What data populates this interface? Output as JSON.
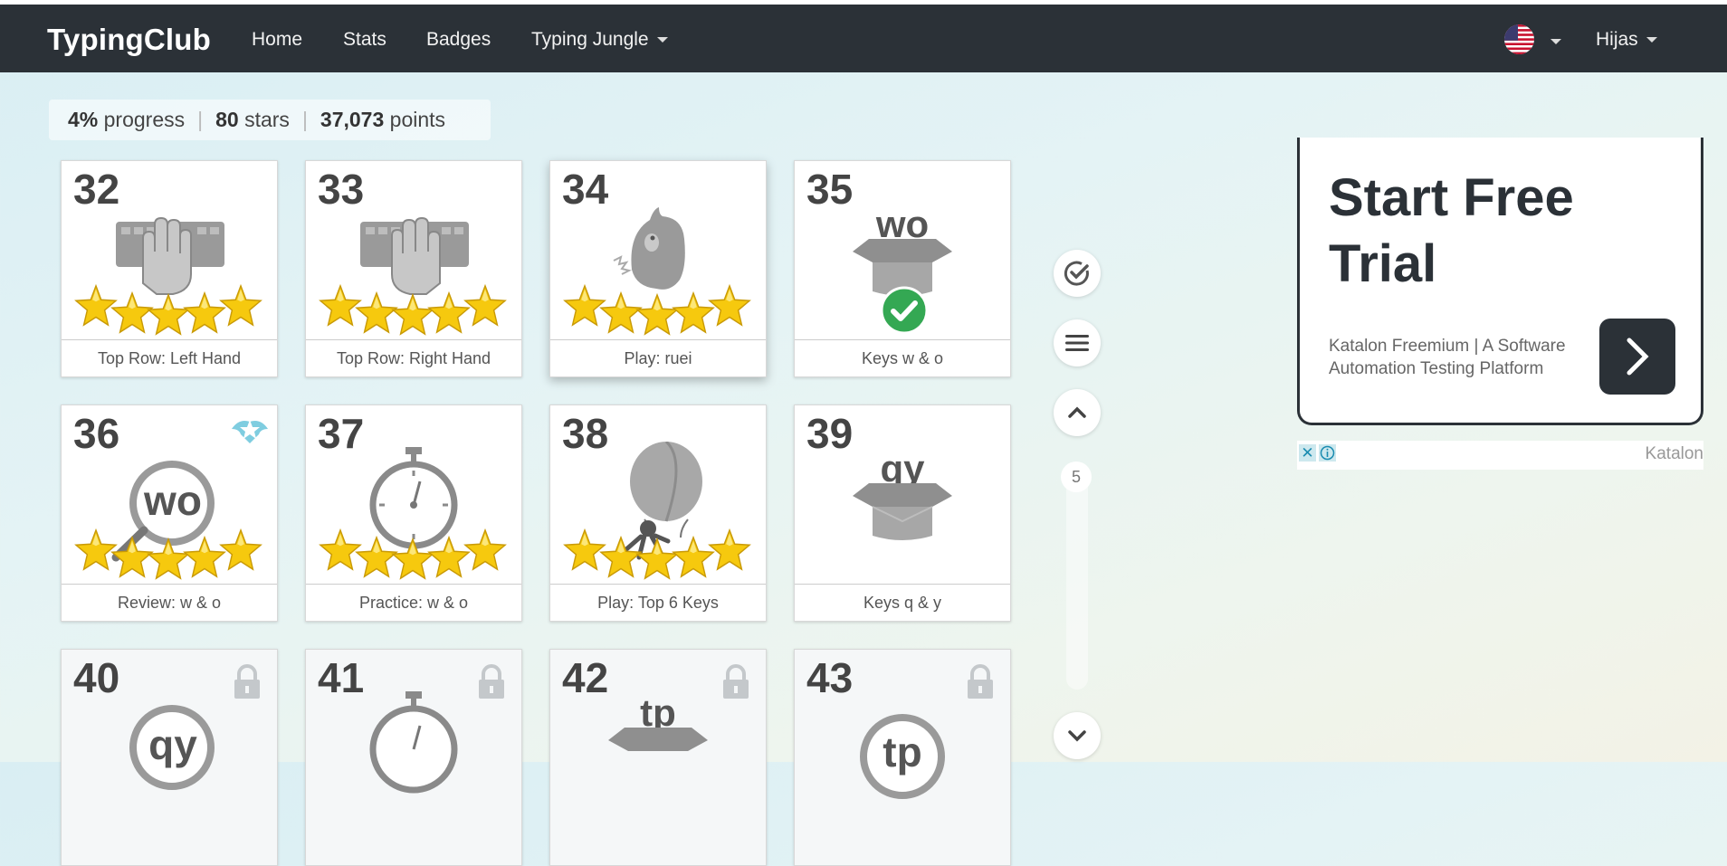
{
  "navbar": {
    "brand": "TypingClub",
    "links": [
      "Home",
      "Stats",
      "Badges",
      "Typing Jungle"
    ],
    "user": "Hijas",
    "language_icon": "us-flag-icon"
  },
  "progress": {
    "percent": "4%",
    "percent_label": "progress",
    "stars": "80",
    "stars_label": "stars",
    "points": "37,073",
    "points_label": "points"
  },
  "lessons": [
    {
      "num": "32",
      "title": "Top Row: Left Hand",
      "stars": 5,
      "icon": "keyboard-left-hand-icon",
      "locked": false
    },
    {
      "num": "33",
      "title": "Top Row: Right Hand",
      "stars": 5,
      "icon": "keyboard-right-hand-icon",
      "locked": false
    },
    {
      "num": "34",
      "title": "Play: ruei",
      "stars": 5,
      "icon": "monster-icon",
      "locked": false
    },
    {
      "num": "35",
      "title": "Keys w & o",
      "stars": 0,
      "icon": "box-icon",
      "box_text": "wo",
      "completed": true,
      "locked": false
    },
    {
      "num": "36",
      "title": "Review: w & o",
      "stars": 5,
      "icon": "magnifier-icon",
      "box_text": "wo",
      "badge": "star-badge-icon",
      "locked": false
    },
    {
      "num": "37",
      "title": "Practice: w & o",
      "stars": 5,
      "icon": "stopwatch-icon",
      "locked": false
    },
    {
      "num": "38",
      "title": "Play: Top 6 Keys",
      "stars": 5,
      "icon": "balloon-icon",
      "locked": false
    },
    {
      "num": "39",
      "title": "Keys q & y",
      "stars": 0,
      "icon": "box-icon",
      "box_text": "qy",
      "locked": false
    },
    {
      "num": "40",
      "title": "",
      "icon": "magnifier-icon",
      "box_text": "qy",
      "locked": true
    },
    {
      "num": "41",
      "title": "",
      "icon": "stopwatch-icon",
      "locked": true
    },
    {
      "num": "42",
      "title": "",
      "icon": "box-icon",
      "box_text": "tp",
      "locked": true
    },
    {
      "num": "43",
      "title": "",
      "icon": "magnifier-icon",
      "box_text": "tp",
      "locked": true
    }
  ],
  "side_controls": {
    "page": "5",
    "icons": [
      "check-circle-icon",
      "menu-icon",
      "chevron-up-icon",
      "chevron-down-icon"
    ]
  },
  "ad": {
    "title": "Start Free Trial",
    "text": "Katalon Freemium | A Software Automation Testing Platform",
    "brand": "Katalon",
    "close": "✕"
  },
  "colors": {
    "navbar": "#2b3137",
    "star": "#f5c518",
    "check": "#34a853"
  }
}
